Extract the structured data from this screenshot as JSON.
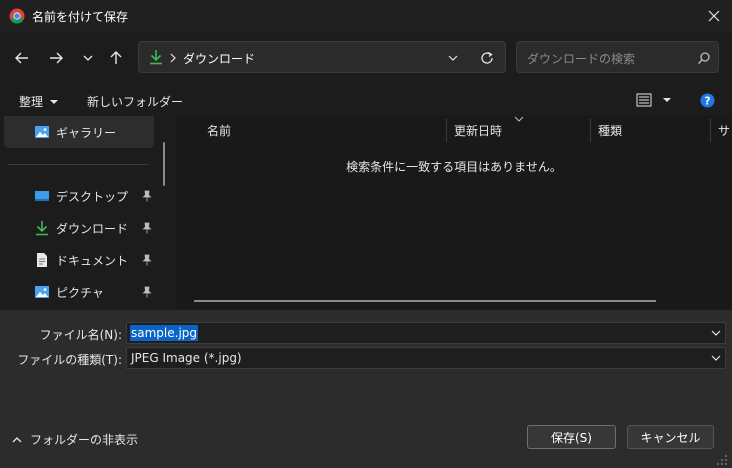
{
  "window": {
    "title": "名前を付けて保存"
  },
  "nav": {
    "address_path": "ダウンロード",
    "search_placeholder": "ダウンロードの検索"
  },
  "toolbar": {
    "organize_label": "整理",
    "new_folder_label": "新しいフォルダー"
  },
  "sidebar": {
    "items": [
      {
        "label": "ギャラリー",
        "icon": "gallery-icon",
        "selected": true
      },
      {
        "label": "デスクトップ",
        "icon": "desktop-icon",
        "pinned": true
      },
      {
        "label": "ダウンロード",
        "icon": "download-icon",
        "pinned": true
      },
      {
        "label": "ドキュメント",
        "icon": "document-icon",
        "pinned": true
      },
      {
        "label": "ピクチャ",
        "icon": "pictures-icon",
        "pinned": true
      }
    ]
  },
  "filelist": {
    "columns": [
      "名前",
      "更新日時",
      "種類",
      "サ"
    ],
    "empty_message": "検索条件に一致する項目はありません。"
  },
  "form": {
    "filename_label": "ファイル名(N):",
    "filename_value": "sample.jpg",
    "filetype_label": "ファイルの種類(T):",
    "filetype_value": "JPEG Image (*.jpg)"
  },
  "buttons": {
    "save": "保存(S)",
    "cancel": "キャンセル",
    "hide_folders": "フォルダーの非表示"
  },
  "colors": {
    "accent": "#0a64c8",
    "download_green": "#3fb950",
    "help_blue": "#1f7ae0"
  }
}
